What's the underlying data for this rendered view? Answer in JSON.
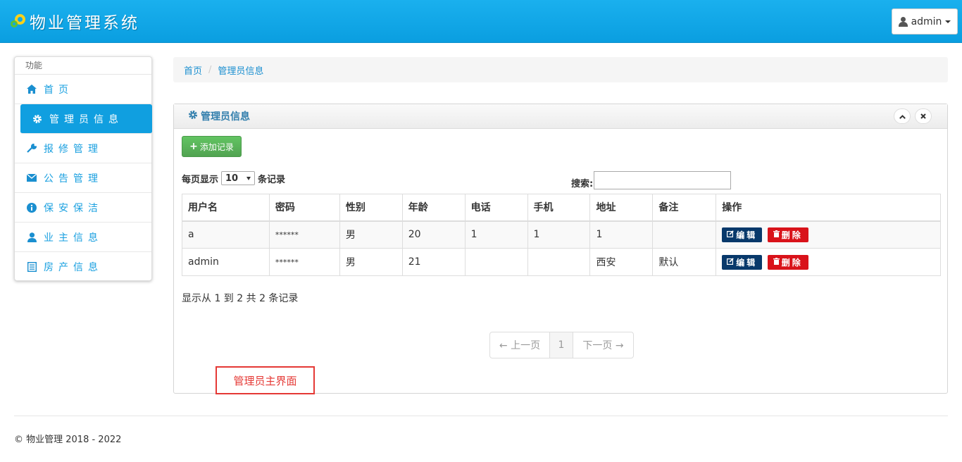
{
  "header": {
    "app_title": "物业管理系统",
    "user_label": "admin"
  },
  "sidebar": {
    "title": "功能",
    "items": [
      {
        "label": "首页",
        "icon": "home-icon"
      },
      {
        "label": "管理员信息",
        "icon": "gear-icon"
      },
      {
        "label": "报修管理",
        "icon": "wrench-icon"
      },
      {
        "label": "公告管理",
        "icon": "envelope-icon"
      },
      {
        "label": "保安保洁",
        "icon": "info-icon"
      },
      {
        "label": "业主信息",
        "icon": "user-icon"
      },
      {
        "label": "房产信息",
        "icon": "list-icon"
      }
    ],
    "active_index": 1
  },
  "breadcrumb": {
    "home": "首页",
    "current": "管理员信息"
  },
  "panel": {
    "title": "管理员信息",
    "add_label": "添加记录",
    "length_prefix": "每页显示",
    "length_value": "10",
    "length_suffix": "条记录",
    "search_label": "搜索:",
    "search_value": "",
    "columns": [
      "用户名",
      "密码",
      "性别",
      "年龄",
      "电话",
      "手机",
      "地址",
      "备注",
      "操作"
    ],
    "rows": [
      {
        "username": "a",
        "password": "******",
        "gender": "男",
        "age": "20",
        "phone": "1",
        "mobile": "1",
        "address": "1",
        "remark": ""
      },
      {
        "username": "admin",
        "password": "******",
        "gender": "男",
        "age": "21",
        "phone": "",
        "mobile": "",
        "address": "西安",
        "remark": "默认"
      }
    ],
    "edit_label": "编辑",
    "delete_label": "删除",
    "info_text": "显示从 1 到 2 共 2 条记录",
    "pager": {
      "prev": "← 上一页",
      "page": "1",
      "next": "下一页 →"
    },
    "annotation": "管理员主界面"
  },
  "footer": {
    "text": "© 物业管理 2018 - 2022"
  },
  "colors": {
    "header_blue": "#0a9ee0",
    "active_nav": "#109fe0",
    "add_green": "#51a351",
    "edit_navy": "#08396b",
    "delete_red": "#d9131a",
    "annotation_red": "#e53935"
  }
}
